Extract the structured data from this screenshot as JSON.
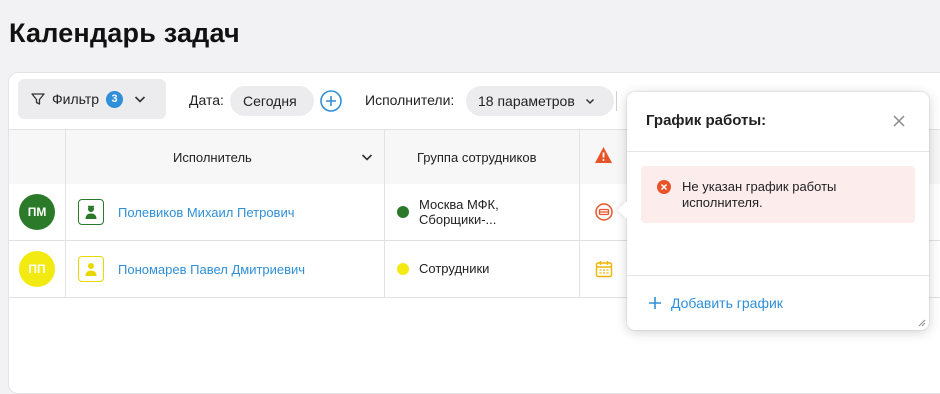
{
  "page": {
    "title": "Календарь задач"
  },
  "toolbar": {
    "filter_label": "Фильтр",
    "filter_count": "3",
    "date_label": "Дата:",
    "date_value": "Сегодня",
    "executors_label": "Исполнители:",
    "executors_value": "18 параметров"
  },
  "table": {
    "headers": {
      "executor": "Исполнитель",
      "group": "Группа сотрудников"
    },
    "rows": [
      {
        "initials": "ПМ",
        "avatar_color": "#2a7a2a",
        "name": "Полевиков Михаил Петрович",
        "group_color": "#2a7a2a",
        "group_line1": "Москва МФК,",
        "group_line2": "Сборщики-...",
        "status_icon": "no-entry-icon"
      },
      {
        "initials": "ПП",
        "avatar_color": "#f2ea10",
        "name": "Пономарев Павел Дмитриевич",
        "group_color": "#f2ea10",
        "group_line1": "Сотрудники",
        "group_line2": "",
        "status_icon": "calendar-icon"
      }
    ]
  },
  "popover": {
    "title": "График работы:",
    "error_text": "Не указан график работы исполнителя.",
    "add_label": "Добавить график"
  },
  "colors": {
    "accent": "#2f8fd8",
    "warning": "#e8542a",
    "error_bg": "#fcecec"
  }
}
